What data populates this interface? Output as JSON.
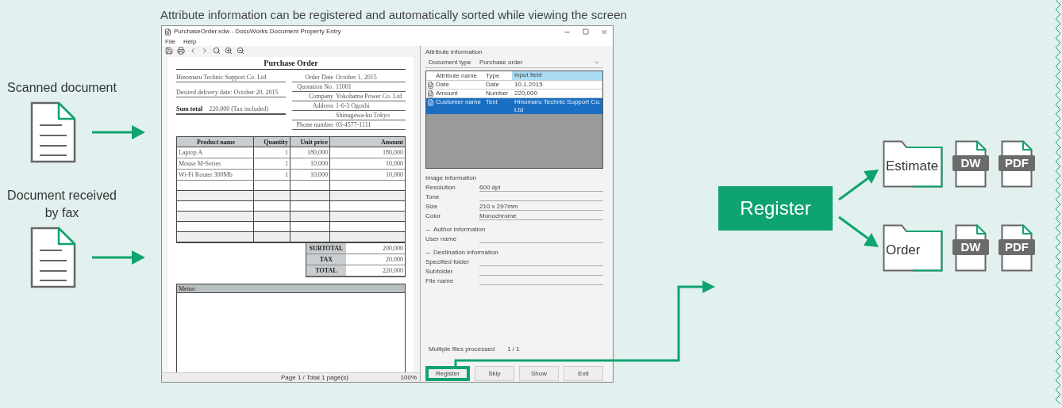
{
  "caption": "Attribute information can be registered and automatically sorted while viewing the screen",
  "inputs": [
    {
      "label": "Scanned document"
    },
    {
      "label": "Document received by fax"
    }
  ],
  "window": {
    "title": "PurchaseOrder.xdw - DocuWorks Document Property Entry",
    "menu": [
      "File",
      "Help"
    ],
    "document": {
      "title": "Purchase Order",
      "left": [
        {
          "kind": "line",
          "text": "Hinomaru Technic Support Co. Ltd"
        },
        {
          "kind": "line",
          "text": "Desired delivery date: October 20, 2015"
        },
        {
          "kind": "sum",
          "label": "Sum total",
          "text": "220,000 (Tax included)"
        }
      ],
      "right": [
        {
          "label": "Order Date",
          "value": "October 1, 2015"
        },
        {
          "label": "Quotation No.",
          "value": "11001"
        },
        {
          "label": "Company",
          "value": "Yokohama Power Co. Ltd"
        },
        {
          "label": "Address",
          "value": "1-6-3 Ogoshi"
        },
        {
          "value": "Shinagawa-ku Tokyo"
        },
        {
          "label": "Phone number",
          "value": "03-4577-1111"
        }
      ],
      "columns": [
        "Product name",
        "Quantity",
        "Unit price",
        "Amount"
      ],
      "rows": [
        [
          "Laptop A",
          "1",
          "180,000",
          "180,000"
        ],
        [
          "Mouse M-Series",
          "1",
          "10,000",
          "10,000"
        ],
        [
          "Wi-Fi Router 300Mb",
          "1",
          "10,000",
          "10,000"
        ]
      ],
      "totals": [
        {
          "label": "SUBTOTAL",
          "value": "200,000"
        },
        {
          "label": "TAX",
          "value": "20,000"
        },
        {
          "label": "TOTAL",
          "value": "220,000"
        }
      ],
      "memo": "Memo"
    },
    "status_bar": {
      "page": "Page 1 / Total 1 page(s)",
      "zoom": "100%"
    },
    "panel": {
      "heading": "Attribute information",
      "doc_type_label": "Document type",
      "doc_type": "Purchase order",
      "columns": [
        "Attribute name",
        "Type",
        "Input field"
      ],
      "rows": [
        {
          "name": "Date",
          "type": "Date",
          "value": "10.1.2015",
          "selected": false
        },
        {
          "name": "Amount",
          "type": "Number",
          "value": "220,000",
          "selected": false
        },
        {
          "name": "Customer name",
          "type": "Text",
          "value": "Hinomaru Technic Support Co. Ltd",
          "selected": true
        }
      ],
      "sections": [
        {
          "heading": "Image information",
          "kind": "plain",
          "fields": [
            {
              "label": "Resolution",
              "value": "600 dpi"
            },
            {
              "label": "Tone"
            },
            {
              "label": "Size",
              "value": "210 x 297mm"
            },
            {
              "label": "Color",
              "value": "Monochrome"
            }
          ]
        },
        {
          "heading": "Author information",
          "kind": "collapsible",
          "fields": [
            {
              "label": "User name"
            }
          ]
        },
        {
          "heading": "Destination information",
          "kind": "collapsible",
          "fields": [
            {
              "label": "Specified folder"
            },
            {
              "label": "Subfolder"
            },
            {
              "label": "File name"
            }
          ]
        }
      ],
      "counter_label": "Multiple files processed",
      "counter": "1 / 1",
      "buttons": [
        {
          "label": "Register",
          "highlighted": true
        },
        {
          "label": "Skip",
          "highlighted": false
        },
        {
          "label": "Show",
          "highlighted": false
        },
        {
          "label": "Exit",
          "highlighted": false
        }
      ]
    }
  },
  "register": "Register",
  "outputs": [
    {
      "folder": "Estimate",
      "files": [
        "DW",
        "PDF"
      ]
    },
    {
      "folder": "Order",
      "files": [
        "DW",
        "PDF"
      ]
    }
  ]
}
